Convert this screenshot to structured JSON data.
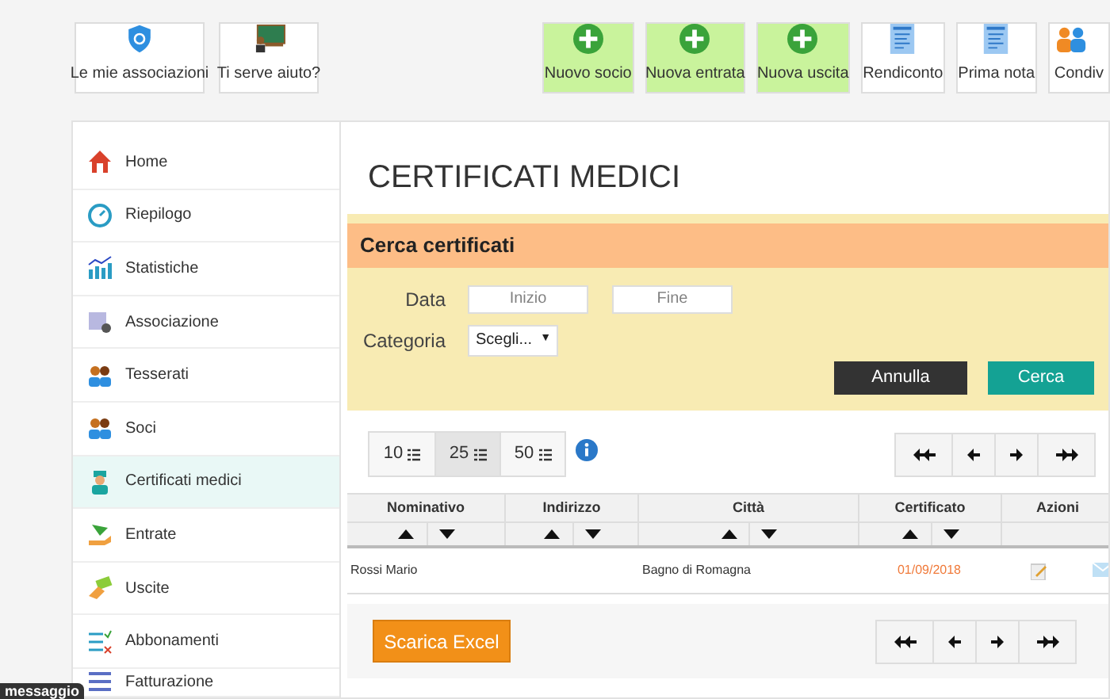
{
  "toolbar_left": [
    {
      "label": "Le mie associazioni",
      "kind": "shield"
    },
    {
      "label": "Ti serve aiuto?",
      "kind": "board"
    }
  ],
  "toolbar_right": [
    {
      "label": "Nuovo socio",
      "kind": "add"
    },
    {
      "label": "Nuova entrata",
      "kind": "add"
    },
    {
      "label": "Nuova uscita",
      "kind": "add"
    },
    {
      "label": "Rendiconto",
      "kind": "doc"
    },
    {
      "label": "Prima nota",
      "kind": "doc"
    },
    {
      "label": "Condiv",
      "kind": "people"
    }
  ],
  "sidebar": {
    "items": [
      {
        "label": "Home",
        "selected": false
      },
      {
        "label": "Riepilogo",
        "selected": false
      },
      {
        "label": "Statistiche",
        "selected": false
      },
      {
        "label": "Associazione",
        "selected": false
      },
      {
        "label": "Tesserati",
        "selected": false
      },
      {
        "label": "Soci",
        "selected": false
      },
      {
        "label": "Certificati medici",
        "selected": true
      },
      {
        "label": "Entrate",
        "selected": false
      },
      {
        "label": "Uscite",
        "selected": false
      },
      {
        "label": "Abbonamenti",
        "selected": false
      },
      {
        "label": "Fatturazione",
        "selected": false
      }
    ]
  },
  "page_title": "CERTIFICATI MEDICI",
  "search": {
    "title": "Cerca certificati",
    "date_label": "Data",
    "start": {
      "placeholder": "Inizio"
    },
    "end": {
      "placeholder": "Fine"
    },
    "category_label": "Categoria",
    "category": {
      "value": "Scegli...",
      "caret": "▼"
    },
    "buttons": [
      {
        "label": "Annulla",
        "kind": "cancel"
      },
      {
        "label": "Cerca",
        "kind": "search"
      }
    ]
  },
  "page_sizes": [
    {
      "label": "10",
      "selected": false
    },
    {
      "label": "25",
      "selected": true
    },
    {
      "label": "50",
      "selected": false
    }
  ],
  "table": {
    "columns": [
      "Nominativo",
      "Indirizzo",
      "Città",
      "Certificato",
      "Azioni"
    ],
    "rows": [
      {
        "nominativo": "Rossi Mario",
        "citta": "Bagno di Romagna",
        "certificato": "01/09/2018",
        "expired": true
      }
    ]
  },
  "export_button": "Scarica Excel",
  "message_tab": "messaggio"
}
